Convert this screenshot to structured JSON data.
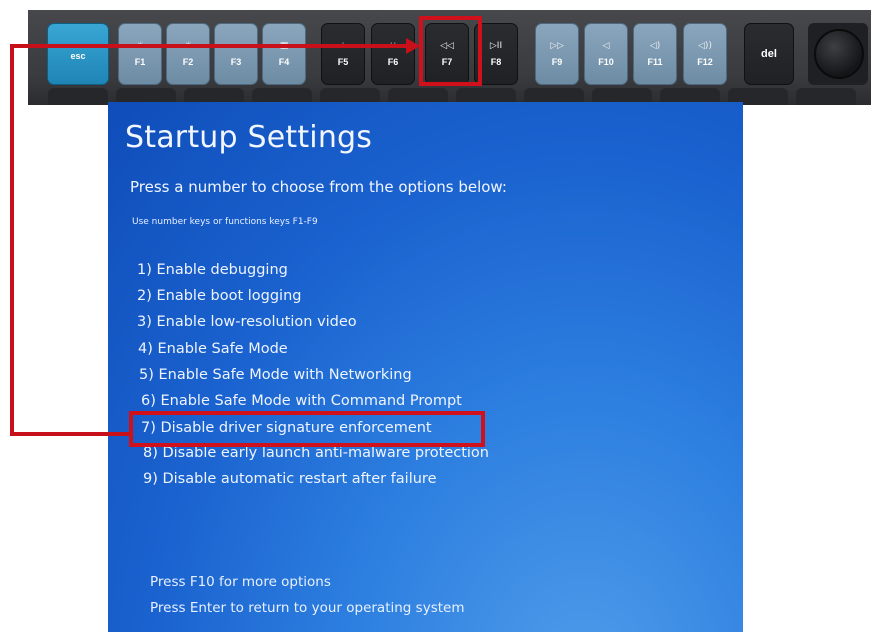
{
  "keyboard": {
    "keys": [
      {
        "id": "esc",
        "label": "esc",
        "symbol": ""
      },
      {
        "id": "f1",
        "label": "F1",
        "symbol": "☼"
      },
      {
        "id": "f2",
        "label": "F2",
        "symbol": "☀"
      },
      {
        "id": "f3",
        "label": "F3",
        "symbol": "▭▭"
      },
      {
        "id": "f4",
        "label": "F4",
        "symbol": "▦"
      },
      {
        "id": "f5",
        "label": "F5",
        "symbol": "⁘"
      },
      {
        "id": "f6",
        "label": "F6",
        "symbol": "⁙"
      },
      {
        "id": "f7",
        "label": "F7",
        "symbol": "◁◁"
      },
      {
        "id": "f8",
        "label": "F8",
        "symbol": "▷II"
      },
      {
        "id": "f9",
        "label": "F9",
        "symbol": "▷▷"
      },
      {
        "id": "f10",
        "label": "F10",
        "symbol": "◁"
      },
      {
        "id": "f11",
        "label": "F11",
        "symbol": "◁)"
      },
      {
        "id": "f12",
        "label": "F12",
        "symbol": "◁))"
      },
      {
        "id": "del",
        "label": "del",
        "symbol": ""
      }
    ]
  },
  "startup": {
    "title": "Startup Settings",
    "subtitle": "Press a number to choose from the options below:",
    "hint": "Use number keys or functions keys F1-F9",
    "options": [
      "1) Enable debugging",
      "2) Enable boot logging",
      "3) Enable low-resolution video",
      "4) Enable Safe Mode",
      "5) Enable Safe Mode with Networking",
      "6) Enable Safe Mode with Command Prompt",
      "7) Disable driver signature enforcement",
      "8) Disable early launch anti-malware protection",
      "9) Disable automatic restart after failure"
    ],
    "footer": [
      "Press F10 for more options",
      "Press Enter to return to your operating system"
    ]
  },
  "annotation": {
    "color": "#d0111b",
    "highlighted_key": "F7",
    "highlighted_option": "7) Disable driver signature enforcement"
  }
}
